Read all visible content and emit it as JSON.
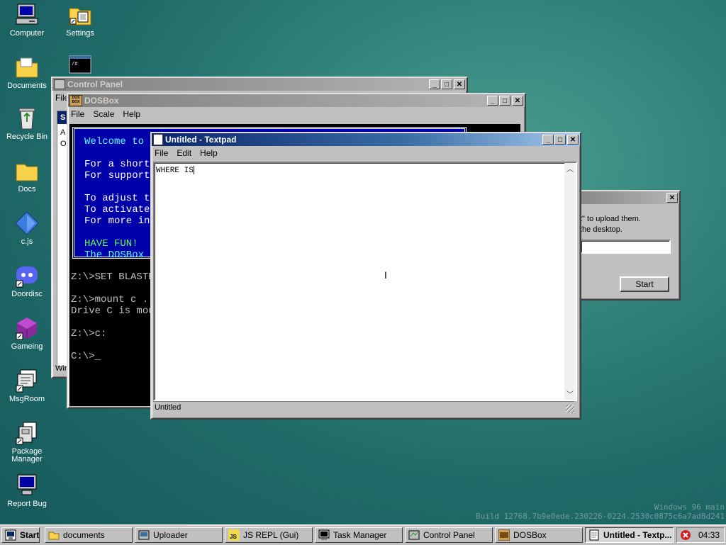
{
  "desktop": {
    "icons": [
      {
        "label": "Computer"
      },
      {
        "label": "Settings"
      },
      {
        "label": "Documents"
      },
      {
        "label": "Recycle Bin"
      },
      {
        "label": "Docs"
      },
      {
        "label": "c.js"
      },
      {
        "label": "Doordisc"
      },
      {
        "label": "Gameing"
      },
      {
        "label": "MsgRoom"
      },
      {
        "label": "Package\nManager"
      },
      {
        "label": "Report Bug"
      }
    ],
    "watermark_line1": "Windows 96 main",
    "watermark_line2": "Build 12768.7b9e0ede.230226-0224.2530c0875c6a7ad8d241"
  },
  "control_panel": {
    "title": "Control Panel",
    "menu_partial": "File",
    "side_letters": [
      "S",
      "A",
      "O"
    ],
    "status_partial": "Win"
  },
  "dosbox": {
    "title": "DOSBox",
    "menu": [
      "File",
      "Scale",
      "Help"
    ],
    "banner_lines": [
      "Welcome to D",
      "",
      "For a short",
      "For supporte",
      "",
      "To adjust th",
      "To activate",
      "For more inf",
      "",
      "HAVE FUN!",
      "The DOSBox T"
    ],
    "console_lines": [
      "Z:\\>SET BLASTE",
      "",
      "Z:\\>mount c .",
      "Drive C is mou",
      "",
      "Z:\\>c:",
      "",
      "C:\\>_"
    ]
  },
  "uploader": {
    "line1": "t\" to upload them.",
    "line2": "the desktop.",
    "input_value": "",
    "start_button": "Start"
  },
  "textpad": {
    "title": "Untitled - Textpad",
    "menu": [
      "File",
      "Edit",
      "Help"
    ],
    "content": "WHERE IS",
    "status": "Untitled"
  },
  "taskbar": {
    "start": "Start",
    "items": [
      {
        "label": "documents",
        "active": false
      },
      {
        "label": "Uploader",
        "active": false
      },
      {
        "label": "JS REPL (Gui)",
        "active": false
      },
      {
        "label": "Task Manager",
        "active": false
      },
      {
        "label": "Control Panel",
        "active": false
      },
      {
        "label": "DOSBox",
        "active": false
      },
      {
        "label": "Untitled - Textp...",
        "active": true
      }
    ],
    "clock": "04:33"
  },
  "colors": {
    "titlebar_active": "#0a246a",
    "dos_blue": "#0000aa",
    "dos_cyan": "#55ffff",
    "dos_green": "#55ff55"
  }
}
